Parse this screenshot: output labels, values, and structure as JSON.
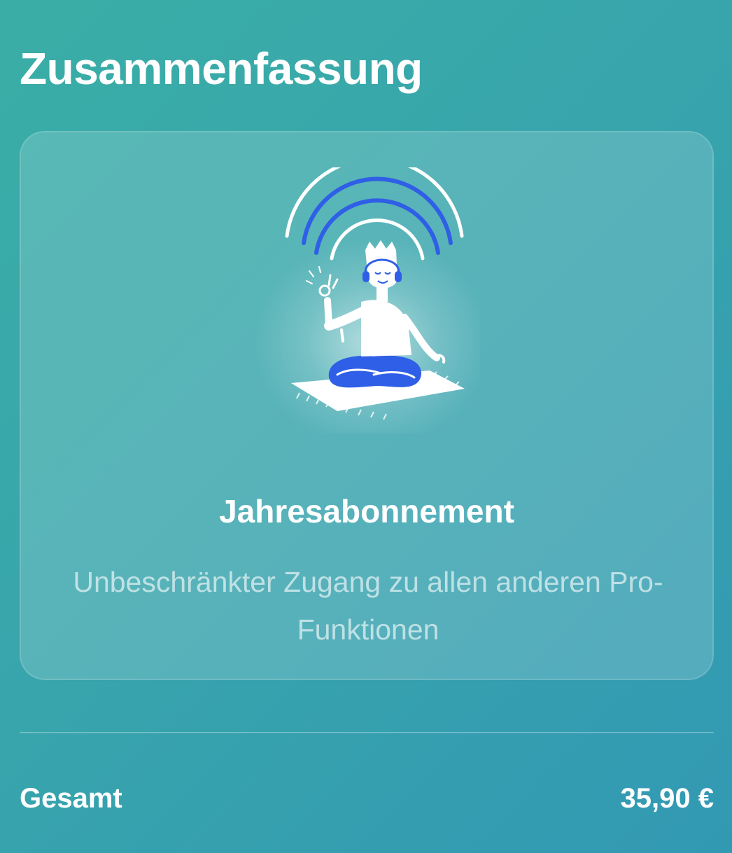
{
  "summary": {
    "title": "Zusammenfassung"
  },
  "plan": {
    "illustration_icon": "meditating-person-with-headphones-icon",
    "name": "Jahresabonnement",
    "description": "Unbeschränkter Zugang zu allen anderen Pro-Funktionen"
  },
  "total": {
    "label": "Gesamt",
    "amount": "35,90 €"
  },
  "colors": {
    "background_start": "#3aaea6",
    "background_end": "#3299b3",
    "accent_blue": "#2f5fe6",
    "text": "#ffffff"
  }
}
